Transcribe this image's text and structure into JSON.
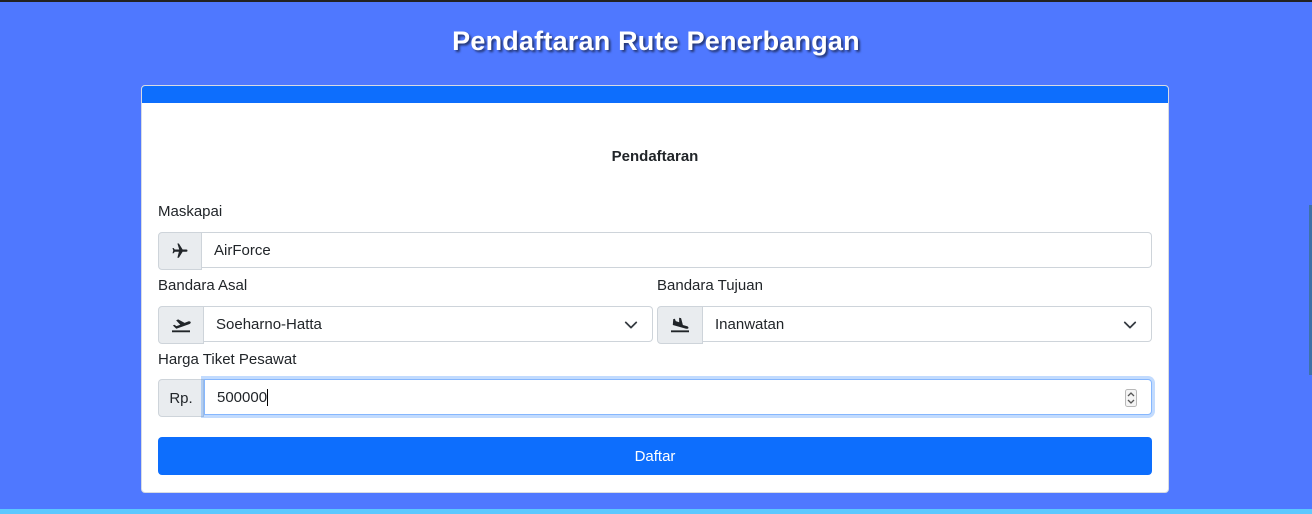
{
  "page": {
    "title": "Pendaftaran Rute Penerbangan"
  },
  "form": {
    "heading": "Pendaftaran",
    "maskapai": {
      "label": "Maskapai",
      "value": "AirForce",
      "icon": "plane-icon"
    },
    "asal": {
      "label": "Bandara Asal",
      "value": "Soeharno-Hatta",
      "icon": "plane-departure-icon"
    },
    "tujuan": {
      "label": "Bandara Tujuan",
      "value": "Inanwatan",
      "icon": "plane-arrival-icon"
    },
    "harga": {
      "label": "Harga Tiket Pesawat",
      "prefix": "Rp.",
      "value": "500000"
    },
    "submit_label": "Daftar"
  },
  "colors": {
    "background": "#4f78ff",
    "primary": "#0d6efd"
  }
}
